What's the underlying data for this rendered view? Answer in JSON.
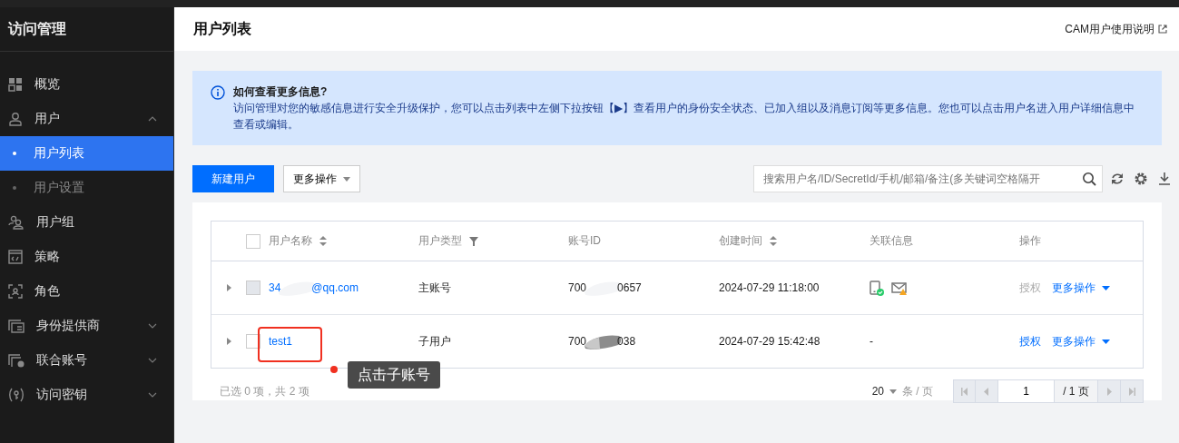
{
  "sidebar": {
    "title": "访问管理",
    "items": [
      {
        "label": "概览",
        "kind": "link",
        "selected": false
      },
      {
        "label": "用户",
        "kind": "group",
        "selected": false,
        "expanded": true,
        "children": [
          {
            "label": "用户列表",
            "selected": true
          },
          {
            "label": "用户设置",
            "selected": false
          }
        ]
      },
      {
        "label": "用户组",
        "kind": "link",
        "selected": false
      },
      {
        "label": "策略",
        "kind": "link",
        "selected": false
      },
      {
        "label": "角色",
        "kind": "link",
        "selected": false
      },
      {
        "label": "身份提供商",
        "kind": "group",
        "selected": false,
        "expanded": false
      },
      {
        "label": "联合账号",
        "kind": "group",
        "selected": false,
        "expanded": false
      },
      {
        "label": "访问密钥",
        "kind": "group",
        "selected": false,
        "expanded": false
      }
    ]
  },
  "header": {
    "title": "用户列表",
    "help_link": "CAM用户使用说明"
  },
  "notice": {
    "title": "如何查看更多信息?",
    "text": "访问管理对您的敏感信息进行安全升级保护，您可以点击列表中左侧下拉按钮【▶】查看用户的身份安全状态、已加入组以及消息订阅等更多信息。您也可以点击用户名进入用户详细信息中查看或编辑。"
  },
  "toolbar": {
    "primary_button": "新建用户",
    "more_button": "更多操作",
    "search": {
      "placeholder": "搜索用户名/ID/SecretId/手机/邮箱/备注(多关键词空格隔开"
    }
  },
  "table": {
    "columns": [
      {
        "label": "用户名称",
        "kind": "sort"
      },
      {
        "label": "用户类型",
        "kind": "filter"
      },
      {
        "label": "账号ID",
        "kind": "plain"
      },
      {
        "label": "创建时间",
        "kind": "sort"
      },
      {
        "label": "关联信息",
        "kind": "plain"
      },
      {
        "label": "操作",
        "kind": "plain"
      }
    ],
    "select_all": {
      "checked": false
    },
    "rows": [
      {
        "expanded": false,
        "checked": false,
        "disabled": true,
        "name_start": "34",
        "name_end": "@qq.com",
        "type": "主账号",
        "id_start": "700",
        "id_end": "0657",
        "created": "2024-07-29 11:18:00",
        "related": [
          {
            "kind": "phone",
            "verified": true,
            "alert": false
          },
          {
            "kind": "mail",
            "verified": false,
            "alert": true
          }
        ],
        "actions": [
          {
            "label": "授权",
            "disabled": true
          },
          {
            "label": "更多操作",
            "disabled": false
          }
        ]
      },
      {
        "expanded": false,
        "checked": false,
        "disabled": false,
        "name_start": "test1",
        "type": "子用户",
        "id_start": "700",
        "id_end": "038",
        "created": "2024-07-29 15:42:48",
        "related_text": "-",
        "actions": [
          {
            "label": "授权",
            "disabled": false
          },
          {
            "label": "更多操作",
            "disabled": false
          }
        ]
      }
    ]
  },
  "footer": {
    "summary": "已选 0 项，共 2 项",
    "page_size": "20",
    "page_size_unit": "条 / 页",
    "page": "1",
    "page_total": "/ 1 页"
  },
  "annotation": {
    "text": "点击子账号"
  }
}
